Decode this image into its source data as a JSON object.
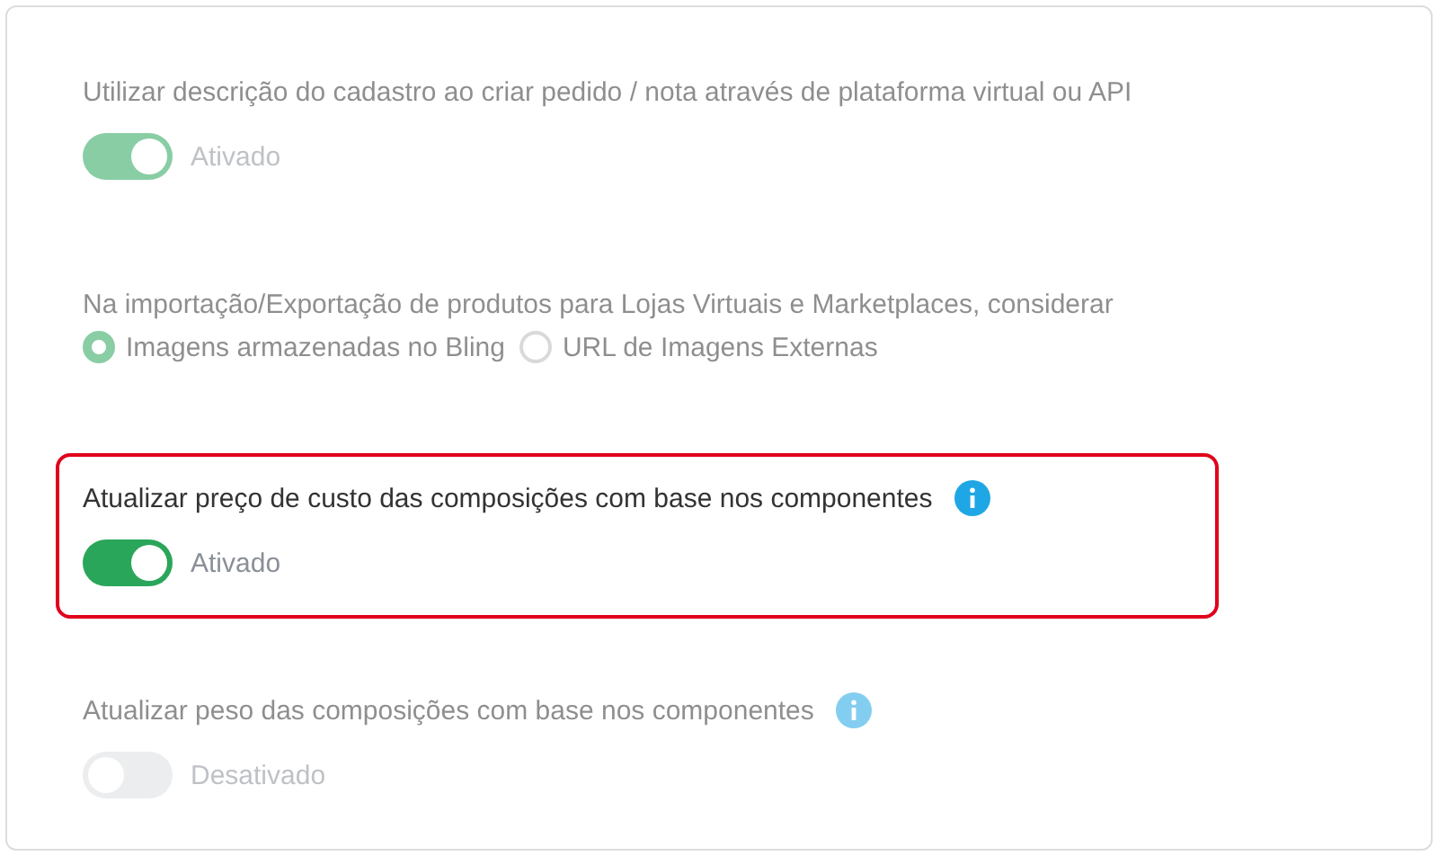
{
  "settings": [
    {
      "kind": "toggle",
      "label": "Utilizar descrição do cadastro ao criar pedido / nota através de plataforma virtual ou API",
      "on": true,
      "status": "Ativado",
      "info": false,
      "highlighted": false,
      "blurred": true
    },
    {
      "kind": "radio",
      "label": "Na importação/Exportação de produtos para Lojas Virtuais e Marketplaces, considerar",
      "options": [
        {
          "label": "Imagens armazenadas no Bling",
          "selected": true
        },
        {
          "label": "URL de Imagens Externas",
          "selected": false
        }
      ],
      "highlighted": false,
      "blurred": true
    },
    {
      "kind": "toggle",
      "label": "Atualizar preço de custo das composições com base nos componentes",
      "on": true,
      "status": "Ativado",
      "info": true,
      "highlighted": true,
      "blurred": false
    },
    {
      "kind": "toggle",
      "label": "Atualizar peso das composições com base nos componentes",
      "on": false,
      "status": "Desativado",
      "info": true,
      "highlighted": false,
      "blurred": true
    }
  ]
}
